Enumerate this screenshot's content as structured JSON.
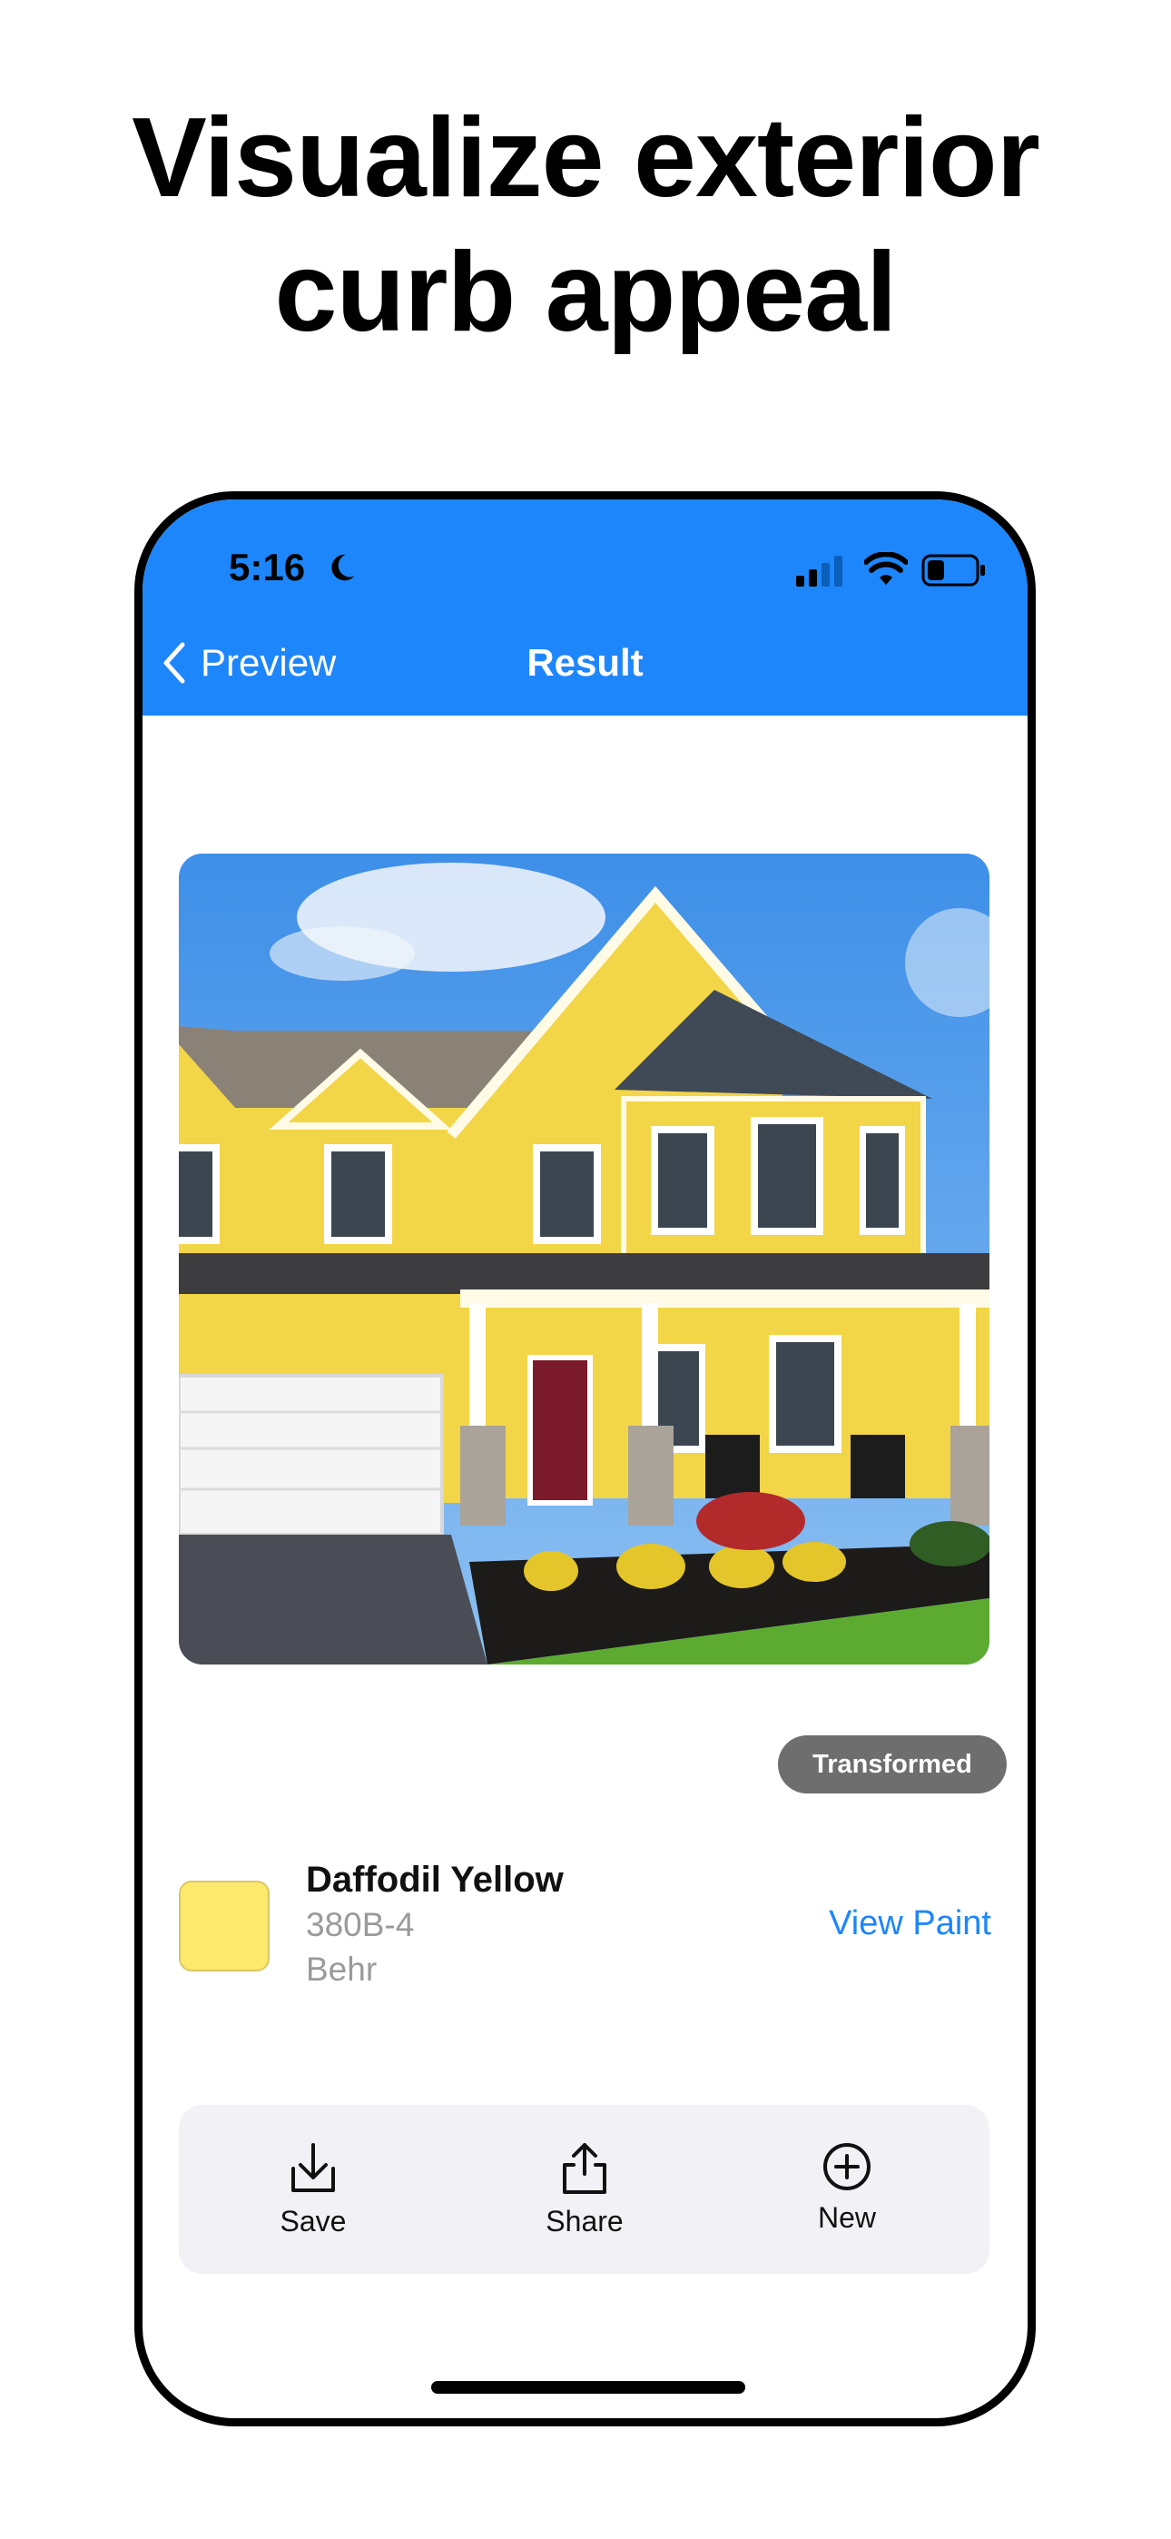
{
  "headline": {
    "line1": "Visualize exterior",
    "line2": "curb appeal"
  },
  "status_bar": {
    "time": "5:16"
  },
  "nav": {
    "back_label": "Preview",
    "title": "Result"
  },
  "image": {
    "badge": "Transformed"
  },
  "paint": {
    "name": "Daffodil Yellow",
    "code": "380B-4",
    "brand": "Behr",
    "swatch_color": "#fde96b",
    "view_label": "View Paint"
  },
  "actions": {
    "save": "Save",
    "share": "Share",
    "new": "New"
  },
  "colors": {
    "accent": "#1e86fb",
    "badge_bg": "#6e6e6e",
    "panel_bg": "#f2f2f6"
  }
}
